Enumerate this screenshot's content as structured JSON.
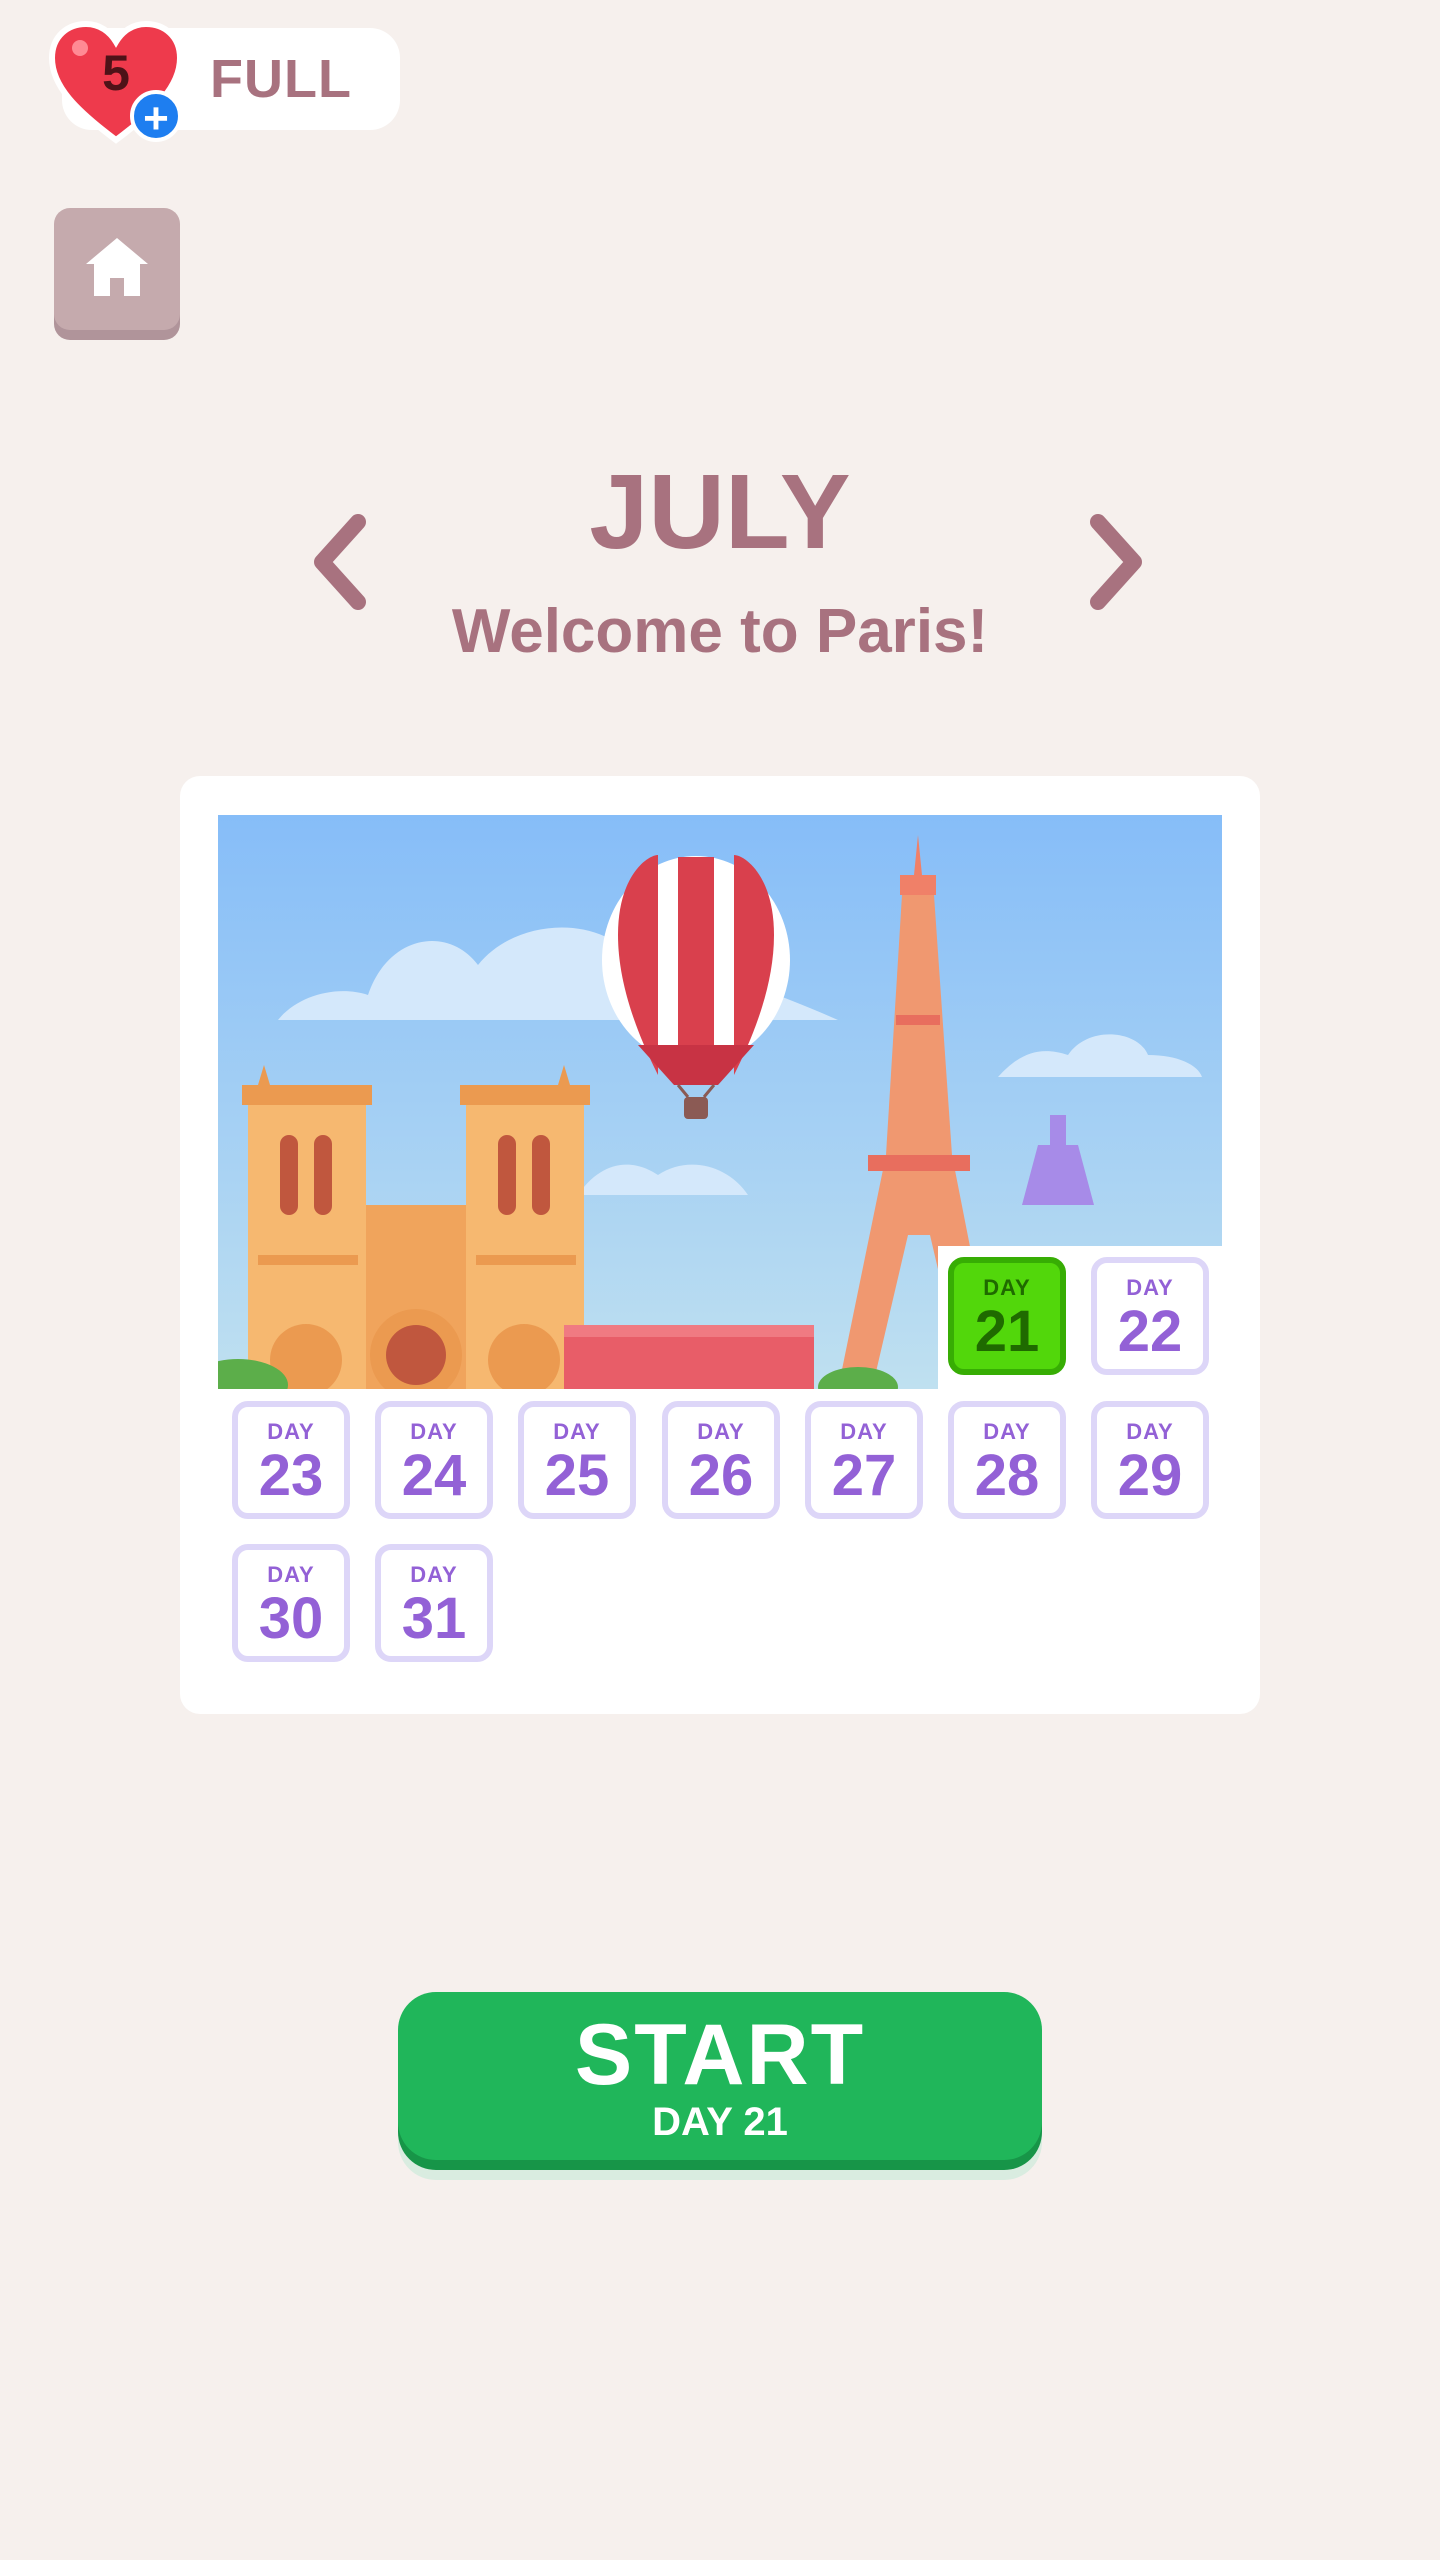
{
  "header": {
    "lives_count": "5",
    "lives_status": "FULL",
    "heart_icon": "heart-icon",
    "add_icon": "plus-icon",
    "home_icon": "home-icon"
  },
  "calendar": {
    "month": "JULY",
    "subtitle": "Welcome to Paris!",
    "prev_icon": "chevron-left-icon",
    "next_icon": "chevron-right-icon"
  },
  "days": {
    "word": "DAY",
    "items": [
      "21",
      "22",
      "23",
      "24",
      "25",
      "26",
      "27",
      "28",
      "29",
      "30",
      "31"
    ],
    "current": "21"
  },
  "start": {
    "label": "START",
    "sublabel": "DAY 21"
  },
  "colors": {
    "background": "#f6f0ed",
    "title": "#a8727f",
    "day_text": "#9361d6",
    "current_day": "#52d70b",
    "start_button": "#20b65a"
  }
}
